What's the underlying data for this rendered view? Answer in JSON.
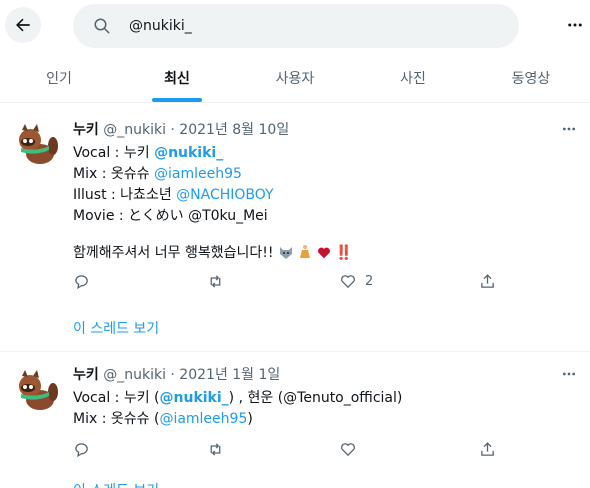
{
  "search": {
    "query": "@nukiki_"
  },
  "tabs": [
    {
      "label": "인기"
    },
    {
      "label": "최신"
    },
    {
      "label": "사용자"
    },
    {
      "label": "사진"
    },
    {
      "label": "동영상"
    }
  ],
  "tweets": [
    {
      "name": "누키",
      "meta": "@_nukiki · 2021년 8월 10일",
      "lines": {
        "vocal_prefix": "Vocal : 누키 ",
        "vocal_link": "@nukiki_",
        "mix_prefix": "Mix : 옷슈슈 ",
        "mix_link": "@iamleeh95",
        "illust_prefix": "Illust : 나쵸소년 ",
        "illust_link": "@NACHIOBOY",
        "movie_text": "Movie : とくめい @T0ku_Mei",
        "thanks_text": "함께해주셔서 너무  행복했습니다!!",
        "thanks_bang": "‼️"
      },
      "actions": {
        "like_count": "2"
      },
      "thread_link": "이 스레드 보기"
    },
    {
      "name": "누키",
      "meta": "@_nukiki · 2021년 1월 1일",
      "lines": {
        "vocal_prefix": "Vocal : 누키 (",
        "vocal_link": "@nukiki_",
        "vocal_suffix": ") , 현운 (@Tenuto_official)",
        "mix_prefix": "Mix : 옷슈슈 (",
        "mix_link": "@iamleeh95",
        "mix_suffix": ")"
      },
      "partial_text": "이 스레드 보기"
    }
  ],
  "icons": [
    "back-arrow-icon",
    "search-icon",
    "more-icon",
    "reply-icon",
    "retweet-icon",
    "like-icon",
    "share-icon",
    "raccoon-avatar"
  ],
  "colors": {
    "accent": "#1d9bf0",
    "text": "#0f1419",
    "muted": "#536471",
    "heart": "#e0245e"
  }
}
